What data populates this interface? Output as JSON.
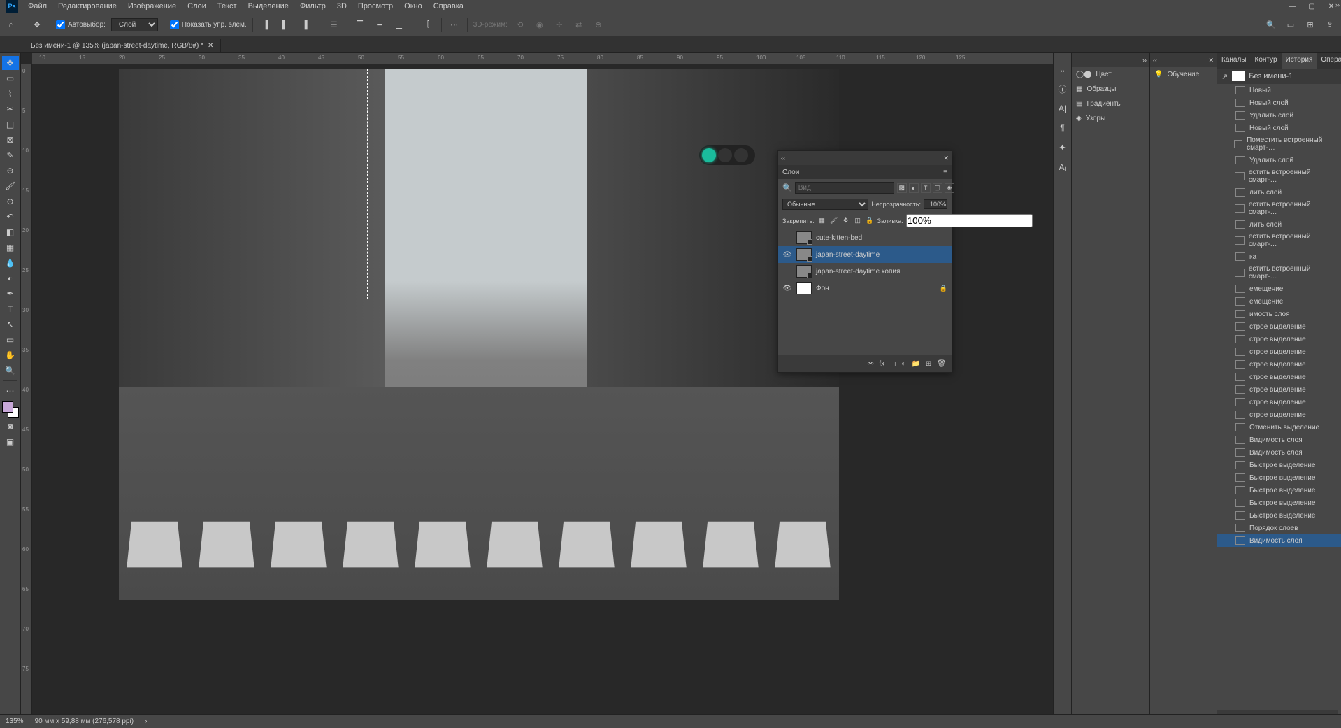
{
  "menu": [
    "Файл",
    "Редактирование",
    "Изображение",
    "Слои",
    "Текст",
    "Выделение",
    "Фильтр",
    "3D",
    "Просмотр",
    "Окно",
    "Справка"
  ],
  "options": {
    "autoselect_label": "Автовыбор:",
    "autoselect_value": "Слой",
    "transform_label": "Показать упр. элем.",
    "mode3d": "3D-режим:"
  },
  "document_tab": "Без имени-1 @ 135% (japan-street-daytime, RGB/8#) *",
  "ruler_ticks_h": [
    "10",
    "15",
    "20",
    "25",
    "30",
    "35",
    "40",
    "45",
    "50",
    "55",
    "60",
    "65",
    "70",
    "75",
    "80",
    "85",
    "90",
    "95",
    "100",
    "105",
    "110",
    "115",
    "120",
    "125"
  ],
  "ruler_ticks_v": [
    "0",
    "5",
    "10",
    "15",
    "20",
    "25",
    "30",
    "35",
    "40",
    "45",
    "50",
    "55",
    "60",
    "65",
    "70",
    "75"
  ],
  "collapsed_panels": [
    {
      "icon": "◯⬤",
      "label": "Цвет"
    },
    {
      "icon": "▦",
      "label": "Образцы"
    },
    {
      "icon": "▤",
      "label": "Градиенты"
    },
    {
      "icon": "◈",
      "label": "Узоры"
    }
  ],
  "learn_label": "Обучение",
  "history_tabs": [
    "Каналы",
    "Контур",
    "История",
    "Операц"
  ],
  "history_doc": "Без имени-1",
  "history": [
    "Новый",
    "Новый слой",
    "Удалить слой",
    "Новый слой",
    "Поместить встроенный смарт-…",
    "Удалить слой",
    "естить встроенный смарт-…",
    "лить слой",
    "естить встроенный смарт-…",
    "лить слой",
    "естить встроенный смарт-…",
    "ка",
    "естить встроенный смарт-…",
    "емещение",
    "емещение",
    "имость слоя",
    "строе выделение",
    "строе выделение",
    "строе выделение",
    "строе выделение",
    "строе выделение",
    "строе выделение",
    "строе выделение",
    "строе выделение",
    "Отменить выделение",
    "Видимость слоя",
    "Видимость слоя",
    "Быстрое выделение",
    "Быстрое выделение",
    "Быстрое выделение",
    "Быстрое выделение",
    "Быстрое выделение",
    "Порядок слоев",
    "Видимость слоя"
  ],
  "layers_panel": {
    "title": "Слои",
    "search_placeholder": "Вид",
    "blend_mode": "Обычные",
    "opacity_label": "Непрозрачность:",
    "opacity_value": "100%",
    "lock_label": "Закрепить:",
    "fill_label": "Заливка:",
    "fill_value": "100%",
    "layers": [
      {
        "visible": false,
        "name": "cute-kitten-bed",
        "thumb": "img",
        "smart": true,
        "locked": false,
        "selected": false
      },
      {
        "visible": true,
        "name": "japan-street-daytime",
        "thumb": "img",
        "smart": true,
        "locked": false,
        "selected": true
      },
      {
        "visible": false,
        "name": "japan-street-daytime копия",
        "thumb": "img",
        "smart": true,
        "locked": false,
        "selected": false
      },
      {
        "visible": true,
        "name": "Фон",
        "thumb": "white",
        "smart": false,
        "locked": true,
        "selected": false
      }
    ]
  },
  "status": {
    "zoom": "135%",
    "doc_info": "90 мм x 59,88 мм (276,578 ppi)"
  }
}
